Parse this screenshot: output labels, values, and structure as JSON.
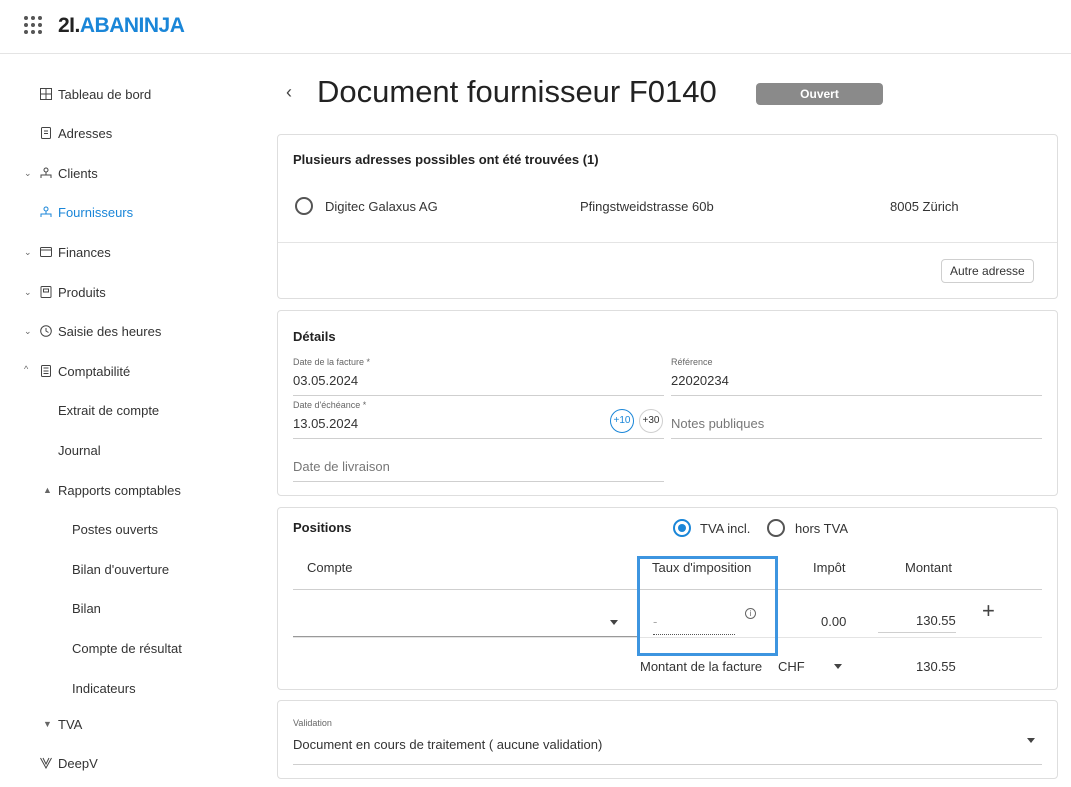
{
  "brand": {
    "part1": "2I.",
    "part2": "ABANINJA"
  },
  "sidebar": {
    "items": [
      {
        "label": "Tableau de bord"
      },
      {
        "label": "Adresses"
      },
      {
        "label": "Clients"
      },
      {
        "label": "Fournisseurs"
      },
      {
        "label": "Finances"
      },
      {
        "label": "Produits"
      },
      {
        "label": "Saisie des heures"
      },
      {
        "label": "Comptabilité"
      },
      {
        "label": "Extrait de compte"
      },
      {
        "label": "Journal"
      },
      {
        "label": "Rapports comptables"
      },
      {
        "label": "Postes ouverts"
      },
      {
        "label": "Bilan d'ouverture"
      },
      {
        "label": "Bilan"
      },
      {
        "label": "Compte de résultat"
      },
      {
        "label": "Indicateurs"
      },
      {
        "label": "TVA"
      },
      {
        "label": "DeepV"
      }
    ]
  },
  "header": {
    "title": "Document fournisseur F0140",
    "status": "Ouvert"
  },
  "addresses": {
    "title": "Plusieurs adresses possibles ont été trouvées (1)",
    "candidate": {
      "name": "Digitec Galaxus AG",
      "street": "Pfingstweidstrasse 60b",
      "city": "8005 Zürich"
    },
    "other_button": "Autre adresse"
  },
  "details": {
    "title": "Détails",
    "invoice_date_label": "Date de la facture *",
    "invoice_date": "03.05.2024",
    "reference_label": "Référence",
    "reference": "22020234",
    "due_date_label": "Date d'échéance *",
    "due_date": "13.05.2024",
    "plus10": "+10",
    "plus30": "+30",
    "public_notes_placeholder": "Notes publiques",
    "delivery_date_placeholder": "Date de livraison"
  },
  "positions": {
    "title": "Positions",
    "vat_incl": "TVA incl.",
    "vat_excl": "hors TVA",
    "col_account": "Compte",
    "col_tax_rate": "Taux d'imposition",
    "col_tax": "Impôt",
    "col_amount": "Montant",
    "row": {
      "tax_rate": "-",
      "tax": "0.00",
      "amount": "130.55"
    },
    "invoice_amount_label": "Montant de la facture",
    "currency": "CHF",
    "invoice_total": "130.55"
  },
  "validation": {
    "label": "Validation",
    "value": "Document en cours de traitement ( aucune validation)"
  }
}
